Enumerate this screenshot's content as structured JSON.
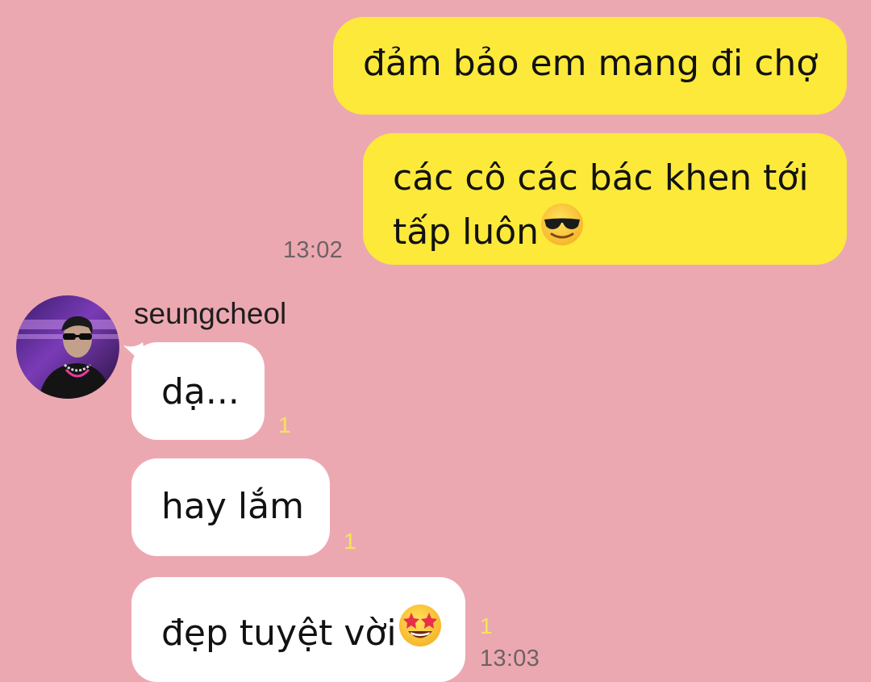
{
  "conversation": {
    "outgoing": [
      {
        "text": "đảm bảo em mang đi chợ"
      },
      {
        "line1": "các cô các bác khen tới",
        "line2": "tấp luôn",
        "emoji": "smiling-face-with-sunglasses-icon"
      }
    ],
    "outgoing_time": "13:02",
    "contact": {
      "name": "seungcheol",
      "avatar": "contact-avatar"
    },
    "incoming": [
      {
        "text": "dạ...",
        "unread": "1"
      },
      {
        "text": "hay lắm",
        "unread": "1"
      },
      {
        "text": "đẹp tuyệt vời",
        "emoji": "star-struck-icon",
        "unread": "1"
      }
    ],
    "incoming_time": "13:03"
  },
  "colors": {
    "background": "#eca8b1",
    "outgoing_bubble": "#fde93a",
    "incoming_bubble": "#ffffff",
    "unread_count": "#f3e65a",
    "timestamp": "#6c6264"
  }
}
